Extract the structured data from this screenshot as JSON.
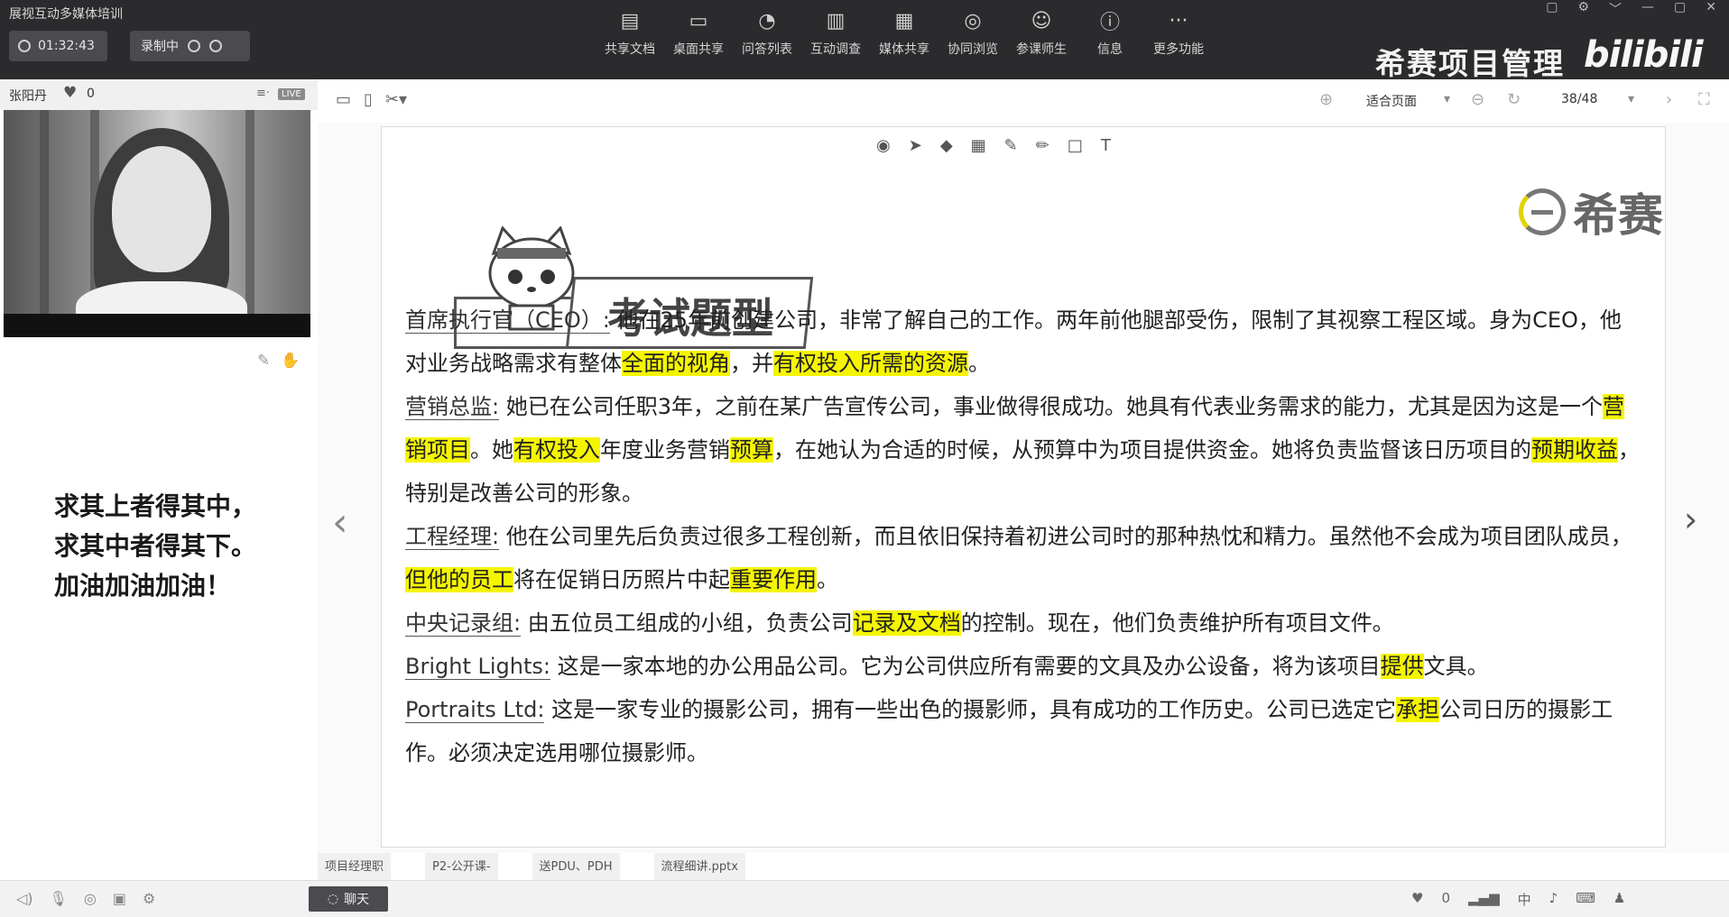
{
  "app": {
    "title": "展视互动多媒体培训"
  },
  "timer": {
    "value": "01:32:43"
  },
  "record": {
    "label": "录制中"
  },
  "toolbar": {
    "items": [
      {
        "label": "共享文档",
        "icon": "doc-share-icon"
      },
      {
        "label": "桌面共享",
        "icon": "desktop-share-icon"
      },
      {
        "label": "问答列表",
        "icon": "qa-icon"
      },
      {
        "label": "互动调查",
        "icon": "poll-icon"
      },
      {
        "label": "媒体共享",
        "icon": "media-icon"
      },
      {
        "label": "协同浏览",
        "icon": "browse-icon"
      },
      {
        "label": "参课师生",
        "icon": "people-icon"
      },
      {
        "label": "信息",
        "icon": "info-icon"
      },
      {
        "label": "更多功能",
        "icon": "more-icon"
      }
    ]
  },
  "brand": {
    "text": "希赛项目管理",
    "bili": "bilibili"
  },
  "presenter": {
    "name": "张阳丹",
    "likes": "0",
    "live_badge": "LIVE"
  },
  "motto": {
    "line1": "求其上者得其中，",
    "line2": "求其中者得其下。",
    "line3": "加油加油加油！"
  },
  "viewer": {
    "fit_label": "适合页面",
    "page": "38/48"
  },
  "slide": {
    "banner_title": "考试题型",
    "logo_text": "希赛",
    "paragraphs": [
      {
        "role": "首席执行官（CEO）:",
        "segments": [
          {
            "text": " 他在25年前创建公司，非常了解自己的工作。两年前他腿部受伤，限制了其视察工程区域。身为CEO，他对业务战略需求有整体",
            "hl": false
          },
          {
            "text": "全面的视角",
            "hl": true
          },
          {
            "text": "，并",
            "hl": false
          },
          {
            "text": "有权投入所需的资源",
            "hl": true
          },
          {
            "text": "。",
            "hl": false
          }
        ]
      },
      {
        "role": "营销总监:",
        "segments": [
          {
            "text": " 她已在公司任职3年，之前在某广告宣传公司，事业做得很成功。她具有代表业务需求的能力，尤其是因为这是一个",
            "hl": false
          },
          {
            "text": "营销项目",
            "hl": true
          },
          {
            "text": "。她",
            "hl": false
          },
          {
            "text": "有权投入",
            "hl": true
          },
          {
            "text": "年度业务营销",
            "hl": false
          },
          {
            "text": "预算",
            "hl": true
          },
          {
            "text": "，在她认为合适的时候，从预算中为项目提供资金。她将负责监督该日历项目的",
            "hl": false
          },
          {
            "text": "预期收益",
            "hl": true
          },
          {
            "text": "，特别是改善公司的形象。",
            "hl": false
          }
        ]
      },
      {
        "role": "工程经理:",
        "segments": [
          {
            "text": " 他在公司里先后负责过很多工程创新，而且依旧保持着初进公司时的那种热忱和精力。虽然他不会成为项目团队成员，",
            "hl": false
          },
          {
            "text": "但他的员工",
            "hl": true
          },
          {
            "text": "将在促销日历照片中起",
            "hl": false
          },
          {
            "text": "重要作用",
            "hl": true
          },
          {
            "text": "。",
            "hl": false
          }
        ]
      },
      {
        "role": "中央记录组:",
        "segments": [
          {
            "text": " 由五位员工组成的小组，负责公司",
            "hl": false
          },
          {
            "text": "记录及文档",
            "hl": true
          },
          {
            "text": "的控制。现在，他们负责维护所有项目文件。",
            "hl": false
          }
        ]
      },
      {
        "role": "Bright Lights:",
        "segments": [
          {
            "text": " 这是一家本地的办公用品公司。它为公司供应所有需要的文具及办公设备，将为该项目",
            "hl": false
          },
          {
            "text": "提供",
            "hl": true
          },
          {
            "text": "文具。",
            "hl": false
          }
        ]
      },
      {
        "role": "Portraits Ltd:",
        "segments": [
          {
            "text": " 这是一家专业的摄影公司，拥有一些出色的摄影师，具有成功的工作历史。公司已选定它",
            "hl": false
          },
          {
            "text": "承担",
            "hl": true
          },
          {
            "text": "公司日历的摄影工作。必须决定选用哪位摄影师。",
            "hl": false
          }
        ]
      }
    ]
  },
  "files": [
    "项目经理职",
    "P2-公开课-",
    "送PDU、PDH",
    "流程细讲.pptx"
  ],
  "chat": {
    "label": "聊天"
  },
  "status": {
    "likes": "0",
    "ime": "中"
  }
}
